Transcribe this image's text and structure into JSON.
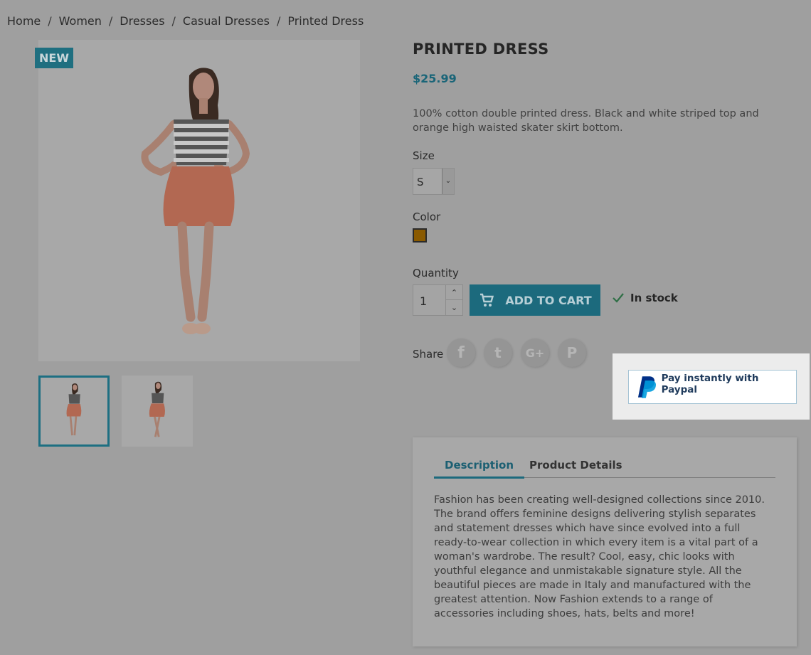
{
  "breadcrumb": [
    "Home",
    "Women",
    "Dresses",
    "Casual Dresses",
    "Printed Dress"
  ],
  "badge": "NEW",
  "product": {
    "title": "PRINTED DRESS",
    "price": "$25.99",
    "short_description": "100% cotton double printed dress. Black and white striped top and orange high waisted skater skirt bottom.",
    "size_label": "Size",
    "size_value": "S",
    "color_label": "Color",
    "color_swatch": "#8a5a00",
    "quantity_label": "Quantity",
    "quantity_value": "1",
    "add_to_cart": "ADD TO CART",
    "stock": "In stock",
    "share_label": "Share"
  },
  "social": [
    {
      "icon": "facebook-icon",
      "glyph": "f"
    },
    {
      "icon": "twitter-icon",
      "glyph": "t"
    },
    {
      "icon": "google-plus-icon",
      "glyph": "G+"
    },
    {
      "icon": "pinterest-icon",
      "glyph": "P"
    }
  ],
  "paypal": {
    "label": "Pay instantly with Paypal"
  },
  "tabs": {
    "description": "Description",
    "details": "Product Details",
    "description_text": "Fashion has been creating well-designed collections since 2010. The brand offers feminine designs delivering stylish separates and statement dresses which have since evolved into a full ready-to-wear collection in which every item is a vital part of a woman's wardrobe. The result? Cool, easy, chic looks with youthful elegance and unmistakable signature style. All the beautiful pieces are made in Italy and manufactured with the greatest attention. Now Fashion extends to a range of accessories including shoes, hats, belts and more!"
  },
  "colors": {
    "accent": "#1c6a7d",
    "overlay": "#9f9f9f",
    "paypal_blue": "#1f3b5c"
  }
}
